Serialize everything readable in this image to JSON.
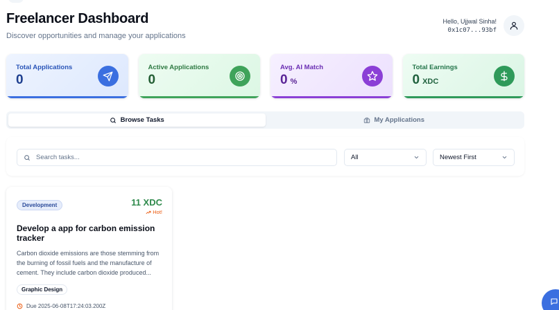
{
  "header": {
    "title": "Freelancer Dashboard",
    "subtitle": "Discover opportunities and manage your applications",
    "greeting": "Hello, Ujjwal Sinha!",
    "wallet": "0x1c07...93bf",
    "avatar_icon": "user-icon"
  },
  "stats": {
    "total_applications": {
      "label": "Total Applications",
      "value": "0",
      "icon": "send-icon"
    },
    "active_applications": {
      "label": "Active Applications",
      "value": "0",
      "icon": "target-icon"
    },
    "ai_match": {
      "label": "Avg. AI Match",
      "value": "0",
      "unit": "%",
      "icon": "star-icon"
    },
    "total_earnings": {
      "label": "Total Earnings",
      "value": "0",
      "unit": "XDC",
      "icon": "dollar-icon"
    }
  },
  "tabs": [
    {
      "label": "Browse Tasks",
      "icon": "search-icon",
      "active": true
    },
    {
      "label": "My Applications",
      "icon": "briefcase-icon",
      "active": false
    }
  ],
  "filters": {
    "search_placeholder": "Search tasks...",
    "category_selected": "All",
    "sort_selected": "Newest First"
  },
  "tasks": [
    {
      "category": "Development",
      "reward": "11 XDC",
      "hot": "Hot!",
      "title": "Develop a app for carbon emission tracker",
      "description": "Carbon dioxide emissions are those stemming from the burning of fossil fuels and the manufacture of cement. They include carbon dioxide produced...",
      "skill": "Graphic Design",
      "due": "Due 2025-06-08T17:24:03.200Z"
    }
  ],
  "colors": {
    "accent_blue": "#3b6fe0",
    "accent_green": "#3fa35a",
    "accent_purple": "#8b3fd6",
    "accent_teal": "#2f9a5a",
    "reward_green": "#2f8a4c",
    "hot_orange": "#ea580c"
  }
}
